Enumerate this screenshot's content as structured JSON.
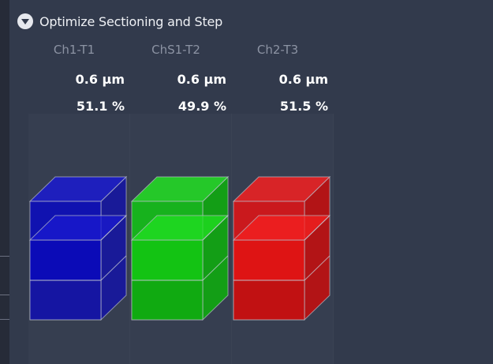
{
  "section": {
    "title": "Optimize Sectioning and Step"
  },
  "channels": [
    {
      "name": "Ch1-T1",
      "step": "0.6 µm",
      "sectioning": "51.1 %",
      "color": "#0b0bb8",
      "front": "#0707c8",
      "top": "#1a1ad0",
      "side": "#1616a0"
    },
    {
      "name": "ChS1-T2",
      "step": "0.6 µm",
      "sectioning": "49.9 %",
      "color": "#13c413",
      "front": "#10d010",
      "top": "#22e022",
      "side": "#0fa80f"
    },
    {
      "name": "Ch2-T3",
      "step": "0.6 µm",
      "sectioning": "51.5 %",
      "color": "#e01414",
      "front": "#f01010",
      "top": "#f52020",
      "side": "#c01010"
    }
  ],
  "colors": {
    "background": "#323a4c",
    "header_text": "#eef0f4",
    "channel_label": "#8c93a3",
    "value_text": "#ffffff"
  }
}
